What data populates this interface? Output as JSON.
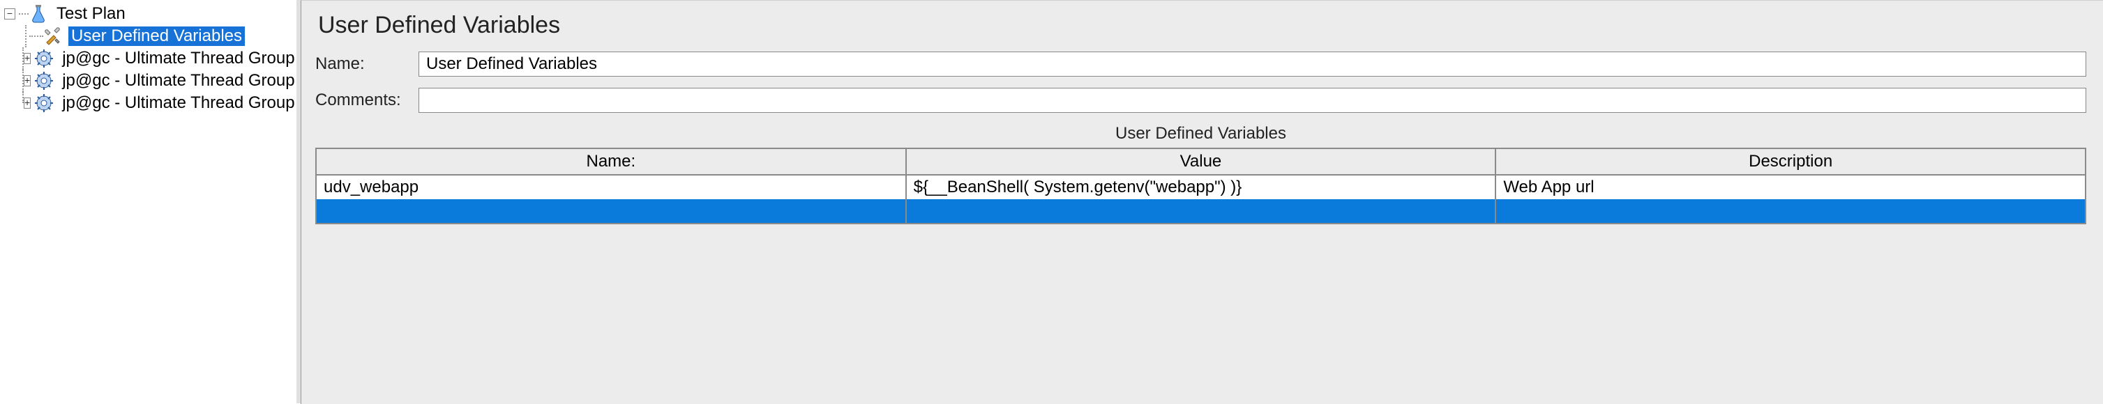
{
  "tree": {
    "root": {
      "label": "Test Plan",
      "icon": "flask-icon"
    },
    "children": [
      {
        "label": "User Defined Variables",
        "icon": "tools-icon",
        "selected": true,
        "expander": null
      },
      {
        "label": "jp@gc - Ultimate Thread Group",
        "icon": "gear-icon",
        "selected": false,
        "expander": "+"
      },
      {
        "label": "jp@gc - Ultimate Thread Group",
        "icon": "gear-icon",
        "selected": false,
        "expander": "+"
      },
      {
        "label": "jp@gc - Ultimate Thread Group",
        "icon": "gear-icon",
        "selected": false,
        "expander": "+"
      }
    ]
  },
  "detail": {
    "title": "User Defined Variables",
    "name_label": "Name:",
    "name_value": "User Defined Variables",
    "comments_label": "Comments:",
    "comments_value": "",
    "table_title": "User Defined Variables",
    "columns": [
      "Name:",
      "Value",
      "Description"
    ],
    "rows": [
      {
        "name": "udv_webapp",
        "value": "${__BeanShell( System.getenv(\"webapp\") )}",
        "description": "Web App url"
      }
    ]
  },
  "glyphs": {
    "minus": "−",
    "plus": "+"
  }
}
